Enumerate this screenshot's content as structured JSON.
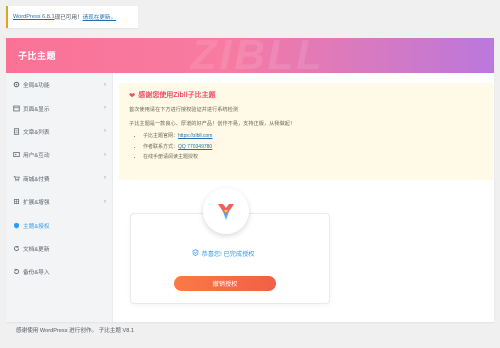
{
  "notice": {
    "prefix": "WordPress 6.8.1",
    "middle": "现已可用！",
    "link": "请现在更新。"
  },
  "header": {
    "title": "子比主题",
    "watermark": "ZIBLL"
  },
  "sidebar": {
    "items": [
      {
        "label": "全局&功能",
        "icon": "gear-icon",
        "chev": "›"
      },
      {
        "label": "页面&显示",
        "icon": "layout-icon",
        "chev": "›"
      },
      {
        "label": "文章&列表",
        "icon": "document-icon",
        "chev": "›"
      },
      {
        "label": "用户&互动",
        "icon": "users-icon",
        "chev": "›"
      },
      {
        "label": "商城&付费",
        "icon": "cart-icon",
        "chev": "›"
      },
      {
        "label": "扩展&增强",
        "icon": "puzzle-icon",
        "chev": "›"
      },
      {
        "label": "主题&授权",
        "icon": "shield-icon",
        "chev": ""
      },
      {
        "label": "文档&更新",
        "icon": "refresh-icon",
        "chev": ""
      },
      {
        "label": "备份&导入",
        "icon": "backup-icon",
        "chev": ""
      }
    ]
  },
  "info": {
    "title": "感谢您使用Zibll子比主题",
    "line1": "首次使用请在下方进行授权验证并进行系统检测",
    "line2": "子比主题是一款良心、厚道的好产品！创作不易，支持正版，从我做起！",
    "items": [
      {
        "label": "子比主题官网：",
        "link": "https://zibll.com"
      },
      {
        "label": "作者联系方式：",
        "link": "QQ 770349780"
      },
      {
        "label": "在线手册请阅读主题授权",
        "link": ""
      }
    ]
  },
  "status": {
    "text": "恭喜您! 已完成授权"
  },
  "button": {
    "label": "撤销授权"
  },
  "footer": {
    "text": "感谢使用 WordPress 进行创作。 子比主题 V8.1"
  },
  "colors": {
    "accent": "#2f9bf6",
    "brand_pink": "#fb7296",
    "brand_purple": "#bb78dc",
    "button": "#f26b45",
    "notice_border": "#dba617"
  }
}
